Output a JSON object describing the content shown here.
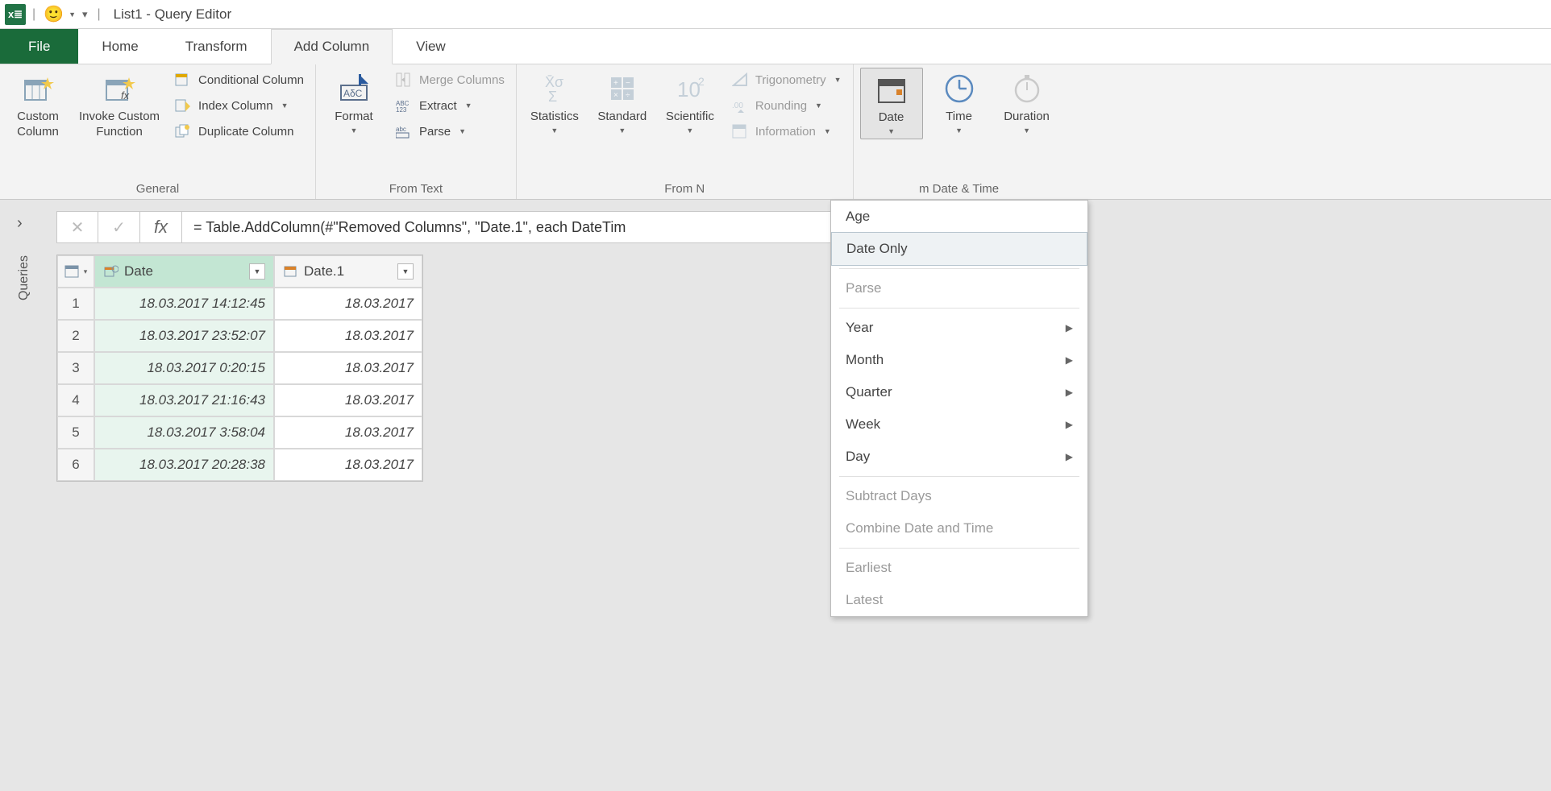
{
  "title": "List1 - Query Editor",
  "tabs": {
    "file": "File",
    "home": "Home",
    "transform": "Transform",
    "addcol": "Add Column",
    "view": "View"
  },
  "ribbon": {
    "general": {
      "label": "General",
      "custom_column": "Custom\nColumn",
      "invoke_custom": "Invoke Custom\nFunction",
      "conditional": "Conditional Column",
      "index": "Index Column",
      "duplicate": "Duplicate Column"
    },
    "fromtext": {
      "label": "From Text",
      "format": "Format",
      "merge": "Merge Columns",
      "extract": "Extract",
      "parse": "Parse"
    },
    "fromnumber": {
      "label": "From N",
      "statistics": "Statistics",
      "standard": "Standard",
      "scientific": "Scientific",
      "trig": "Trigonometry",
      "rounding": "Rounding",
      "information": "Information"
    },
    "fromdatetime": {
      "label": "m Date & Time",
      "date": "Date",
      "time": "Time",
      "duration": "Duration"
    }
  },
  "dropdown": {
    "age": "Age",
    "date_only": "Date Only",
    "parse": "Parse",
    "year": "Year",
    "month": "Month",
    "quarter": "Quarter",
    "week": "Week",
    "day": "Day",
    "subtract": "Subtract Days",
    "combine": "Combine Date and Time",
    "earliest": "Earliest",
    "latest": "Latest"
  },
  "side_panel": "Queries",
  "formula": "= Table.AddColumn(#\"Removed Columns\", \"Date.1\", each DateTim",
  "table": {
    "headers": {
      "c1": "Date",
      "c2": "Date.1"
    },
    "rows": [
      {
        "n": "1",
        "date": "18.03.2017 14:12:45",
        "date1": "18.03.2017"
      },
      {
        "n": "2",
        "date": "18.03.2017 23:52:07",
        "date1": "18.03.2017"
      },
      {
        "n": "3",
        "date": "18.03.2017 0:20:15",
        "date1": "18.03.2017"
      },
      {
        "n": "4",
        "date": "18.03.2017 21:16:43",
        "date1": "18.03.2017"
      },
      {
        "n": "5",
        "date": "18.03.2017 3:58:04",
        "date1": "18.03.2017"
      },
      {
        "n": "6",
        "date": "18.03.2017 20:28:38",
        "date1": "18.03.2017"
      }
    ]
  }
}
